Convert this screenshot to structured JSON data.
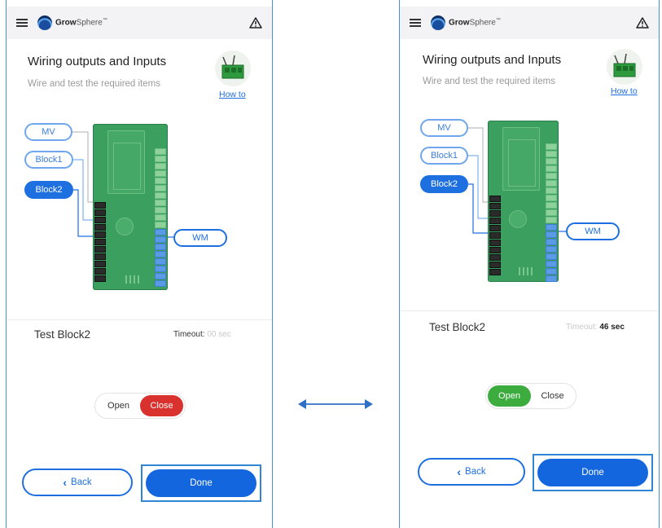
{
  "app": {
    "brand_bold": "Grow",
    "brand_light": "Sphere",
    "brand_mark": "™"
  },
  "icons": {
    "menu": "hamburger-menu-icon",
    "alert": "warning-triangle-icon",
    "back": "chevron-left-icon",
    "swap": "double-arrow-icon"
  },
  "colors": {
    "primary": "#1e6fe0",
    "close_active": "#d9312d",
    "open_active": "#3cac3f",
    "board": "#3b9f5f"
  },
  "screens": [
    {
      "title": "Wiring outputs and Inputs",
      "subtitle": "Wire and test the required items",
      "how_to": "How to",
      "tags": {
        "mv": "MV",
        "block1": "Block1",
        "block2": "Block2",
        "wm": "WM"
      },
      "test_label": "Test Block2",
      "timeout_label": "Timeout:",
      "timeout_value": "00 sec",
      "toggle": {
        "open": "Open",
        "close": "Close",
        "active": "close"
      },
      "back_label": "Back",
      "done_label": "Done"
    },
    {
      "title": "Wiring outputs and Inputs",
      "subtitle": "Wire and test the required items",
      "how_to": "How to",
      "tags": {
        "mv": "MV",
        "block1": "Block1",
        "block2": "Block2",
        "wm": "WM"
      },
      "test_label": "Test Block2",
      "timeout_label": "Timeout:",
      "timeout_value": "46 sec",
      "toggle": {
        "open": "Open",
        "close": "Close",
        "active": "open"
      },
      "back_label": "Back",
      "done_label": "Done"
    }
  ]
}
